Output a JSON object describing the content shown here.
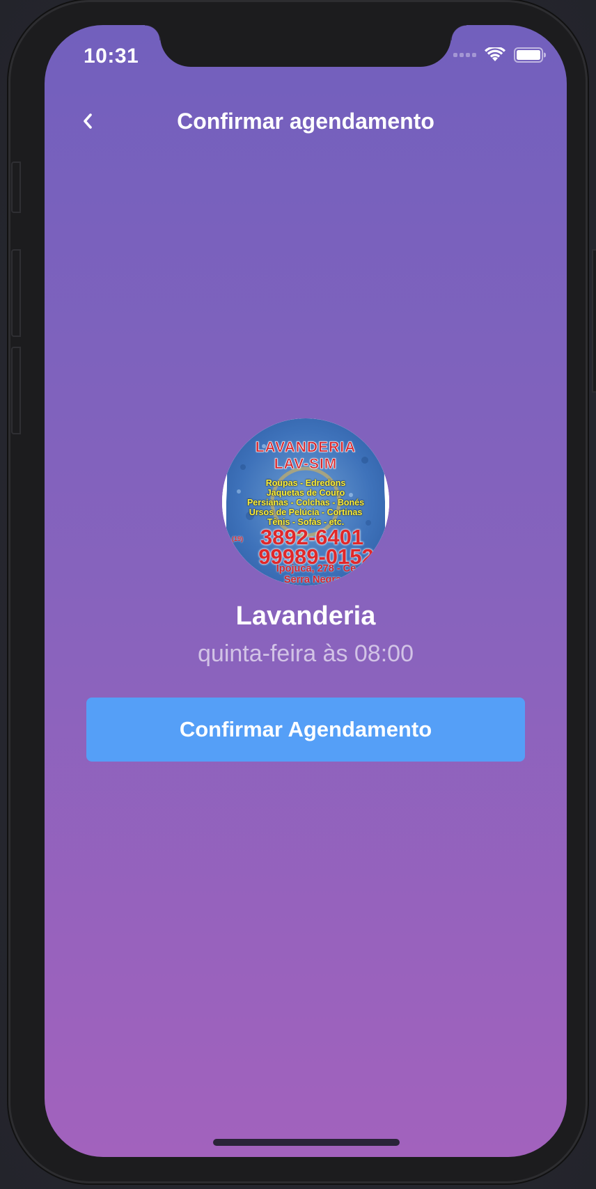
{
  "status_bar": {
    "time": "10:31",
    "icons": [
      "signal-icon",
      "wifi-icon",
      "battery-icon"
    ]
  },
  "header": {
    "back_icon": "chevron-left-icon",
    "title": "Confirmar agendamento"
  },
  "provider": {
    "avatar": {
      "title_line1": "LAVANDERIA",
      "title_line2": "LAV-SIM",
      "services": [
        "Roupas - Edredons",
        "Jaquetas de Couro",
        "Persianas - Colchas - Bonés",
        "Ursos de Pelúcia - Cortinas",
        "Tênis - Sofás - etc."
      ],
      "area_code": "(19)",
      "phone_1": "3892-6401",
      "phone_2": "99989-0152",
      "address_line1": "Ipojuca, 278 - Ce",
      "address_line2": "Serra Negra"
    },
    "name": "Lavanderia",
    "schedule": "quinta-feira às 08:00"
  },
  "actions": {
    "confirm_label": "Confirmar Agendamento"
  },
  "colors": {
    "gradient_top": "#7260bd",
    "gradient_bottom": "#a262bd",
    "button": "#559ff7",
    "text": "#ffffff"
  }
}
